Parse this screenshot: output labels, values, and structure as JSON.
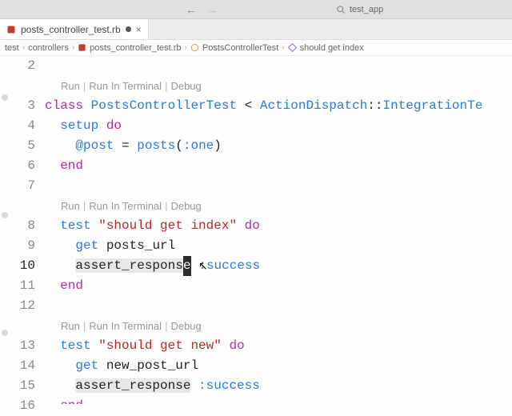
{
  "titlebar": {
    "project": "test_app"
  },
  "tab": {
    "filename": "posts_controller_test.rb",
    "dirty": true
  },
  "breadcrumbs": {
    "seg0": "test",
    "seg1": "controllers",
    "seg2": "posts_controller_test.rb",
    "seg3": "PostsControllerTest",
    "seg4": "should get index"
  },
  "codelens": {
    "run": "Run",
    "run_terminal": "Run In Terminal",
    "debug": "Debug"
  },
  "lines": {
    "l2": "2",
    "l3": "3",
    "l4": "4",
    "l5": "5",
    "l6": "6",
    "l7": "7",
    "l8": "8",
    "l9": "9",
    "l10": "10",
    "l11": "11",
    "l12": "12",
    "l13": "13",
    "l14": "14",
    "l15": "15",
    "l16": "16"
  },
  "code": {
    "class_kw": "class",
    "class_name": "PostsControllerTest",
    "lt": " < ",
    "dispatch": "ActionDispatch",
    "dcolon": "::",
    "integ": "IntegrationTe",
    "setup": "setup",
    "do": "do",
    "ivar": "@post",
    "eq": " = ",
    "posts_call": "posts",
    "lparen": "(",
    "sym_one": ":one",
    "rparen": ")",
    "end": "end",
    "test_kw": "test",
    "str_index": "\"should get index\"",
    "get": "get",
    "posts_url": "posts_url",
    "assert_prefix": "assert_respons",
    "assert_lastchar": "e",
    "assert_full": "assert_response",
    "sym_success": ":success",
    "str_new": "\"should get new\"",
    "new_post_url": "new_post_url"
  }
}
